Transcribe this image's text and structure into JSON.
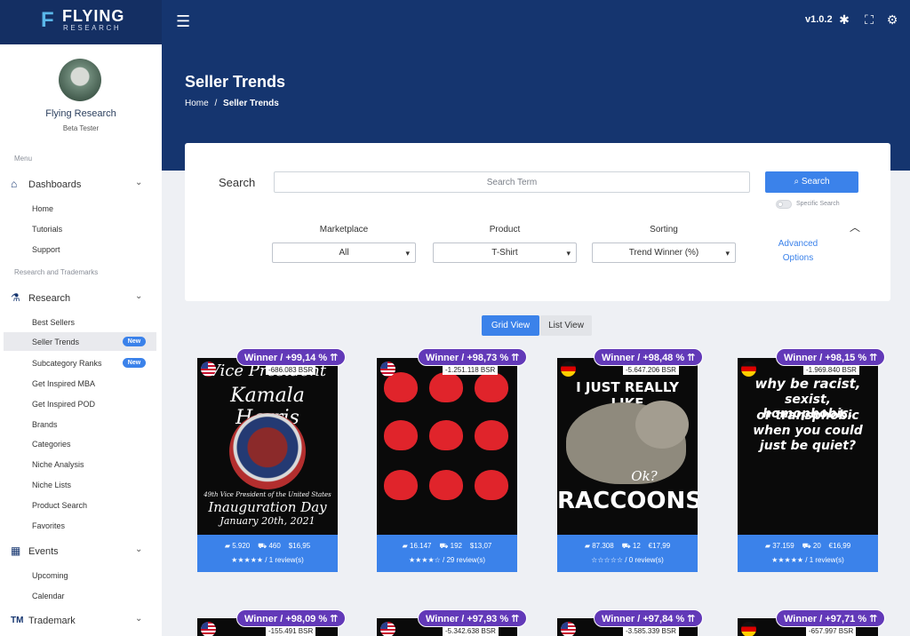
{
  "brand": {
    "name": "FLYING",
    "subname": "RESEARCH"
  },
  "topbar": {
    "version": "v1.0.2"
  },
  "user": {
    "name": "Flying Research",
    "role": "Beta Tester"
  },
  "sidebar": {
    "section_menu": "Menu",
    "dashboards": {
      "label": "Dashboards",
      "items": [
        "Home",
        "Tutorials",
        "Support"
      ]
    },
    "section_research": "Research and Trademarks",
    "research": {
      "label": "Research",
      "items": [
        "Best Sellers",
        "Seller Trends",
        "Subcategory Ranks",
        "Get Inspired MBA",
        "Get Inspired POD",
        "Brands",
        "Categories",
        "Niche Analysis",
        "Niche Lists",
        "Product Search",
        "Favorites"
      ],
      "badge": "New"
    },
    "events": {
      "label": "Events",
      "items": [
        "Upcoming",
        "Calendar"
      ]
    },
    "trademark": {
      "label": "Trademark"
    }
  },
  "page": {
    "title": "Seller Trends",
    "breadcrumb_home": "Home",
    "breadcrumb_sep": "/",
    "breadcrumb_current": "Seller Trends"
  },
  "search": {
    "label": "Search",
    "placeholder": "Search Term",
    "button": "Search",
    "specific": "Specific Search",
    "marketplace_label": "Marketplace",
    "marketplace_value": "All",
    "product_label": "Product",
    "product_value": "T-Shirt",
    "sorting_label": "Sorting",
    "sorting_value": "Trend Winner (%)",
    "advanced_line1": "Advanced",
    "advanced_line2": "Options"
  },
  "views": {
    "grid": "Grid View",
    "list": "List View"
  },
  "products": [
    {
      "winner": "Winner / +99,14 %",
      "bsr": "-686.083 BSR",
      "reviews_count": "5.920",
      "sales": "460",
      "price": "$16,95",
      "stars": "★★★★★",
      "reviews": "1 review(s)",
      "flag": "us",
      "art1": "Vice President",
      "art2": "Kamala Harris",
      "art3": "49th Vice President of the United States",
      "art4": "Inauguration Day",
      "art5": "January 20th, 2021"
    },
    {
      "winner": "Winner / +98,73 %",
      "bsr": "-1.251.118 BSR",
      "reviews_count": "16.147",
      "sales": "192",
      "price": "$13,07",
      "stars": "★★★★☆",
      "reviews": "29 review(s)",
      "flag": "us"
    },
    {
      "winner": "Winner / +98,48 %",
      "bsr": "-5.647.206 BSR",
      "reviews_count": "87.308",
      "sales": "12",
      "price": "€17,99",
      "stars": "☆☆☆☆☆",
      "reviews": "0 review(s)",
      "flag": "de",
      "art1": "I JUST REALLY LIKE",
      "art2": "Ok?",
      "art3": "RACCOONS"
    },
    {
      "winner": "Winner / +98,15 %",
      "bsr": "-1.969.840 BSR",
      "reviews_count": "37.159",
      "sales": "20",
      "price": "€16,99",
      "stars": "★★★★★",
      "reviews": "1 review(s)",
      "flag": "de",
      "art1": "why be racist,",
      "art2": "sexist, homophobic,",
      "art3": "or transphobic",
      "art4": "when you could",
      "art5": "just be quiet?"
    }
  ],
  "products_row2": [
    {
      "winner": "Winner / +98,09 %",
      "bsr": "-155.491 BSR",
      "flag": "us"
    },
    {
      "winner": "Winner / +97,93 %",
      "bsr": "-5.342.638 BSR",
      "flag": "us"
    },
    {
      "winner": "Winner / +97,84 %",
      "bsr": "-3.585.339 BSR",
      "flag": "us"
    },
    {
      "winner": "Winner / +97,71 %",
      "bsr": "-657.997 BSR",
      "flag": "de"
    }
  ],
  "icons": {
    "up": "⇈",
    "trend": "📈",
    "cart": "🛒"
  }
}
